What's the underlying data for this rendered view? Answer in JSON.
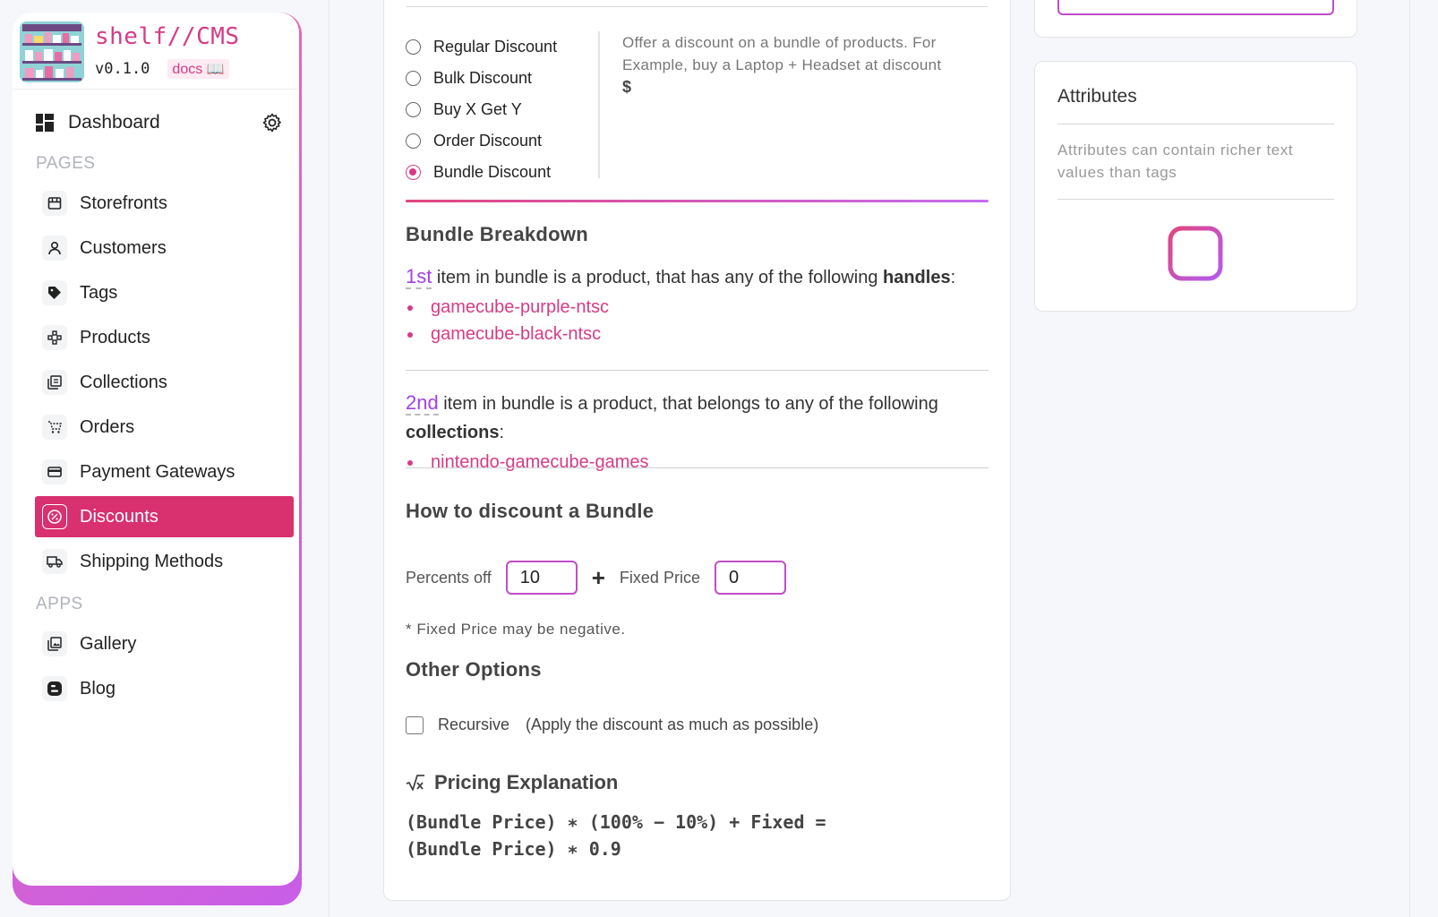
{
  "brand": {
    "name": "shelf//CMS",
    "version": "v0.1.0",
    "docs": "docs 📖"
  },
  "sidebar": {
    "dashboard": "Dashboard",
    "pages_label": "PAGES",
    "apps_label": "APPS",
    "pages": [
      {
        "label": "Storefronts",
        "icon": "storefront-icon"
      },
      {
        "label": "Customers",
        "icon": "user-icon"
      },
      {
        "label": "Tags",
        "icon": "tag-icon"
      },
      {
        "label": "Products",
        "icon": "products-icon"
      },
      {
        "label": "Collections",
        "icon": "collections-icon"
      },
      {
        "label": "Orders",
        "icon": "cart-icon"
      },
      {
        "label": "Payment Gateways",
        "icon": "credit-card-icon"
      },
      {
        "label": "Discounts",
        "icon": "discount-icon",
        "active": true
      },
      {
        "label": "Shipping Methods",
        "icon": "truck-icon"
      }
    ],
    "apps": [
      {
        "label": "Gallery",
        "icon": "gallery-icon"
      },
      {
        "label": "Blog",
        "icon": "blog-icon"
      }
    ]
  },
  "discount_types": {
    "options": [
      "Regular Discount",
      "Bulk Discount",
      "Buy X Get Y",
      "Order Discount",
      "Bundle Discount"
    ],
    "selected": "Bundle Discount",
    "description": "Offer a discount on a bundle of products. For Example, buy a Laptop + Headset at discount",
    "description_symbol": "$"
  },
  "bundle_breakdown": {
    "title": "Bundle Breakdown",
    "items": [
      {
        "ordinal": "1st",
        "text": " item in bundle is a product, that has any of the following ",
        "kind": "handles",
        "values": [
          "gamecube-purple-ntsc",
          "gamecube-black-ntsc"
        ]
      },
      {
        "ordinal": "2nd",
        "text": " item in bundle is a product, that belongs to any of the following ",
        "kind": "collections",
        "values": [
          "nintendo-gamecube-games"
        ]
      }
    ]
  },
  "how_to_discount": {
    "title": "How to discount a Bundle",
    "percents_label": "Percents off",
    "percents_value": "10",
    "plus": "+",
    "fixed_label": "Fixed Price",
    "fixed_value": "0",
    "note": "* Fixed Price may be negative."
  },
  "other_options": {
    "title": "Other Options",
    "recursive_label": "Recursive",
    "recursive_hint": "(Apply the discount as much as possible)",
    "recursive_checked": false
  },
  "pricing": {
    "title": "Pricing Explanation",
    "formula_line1": "(Bundle Price) ∗ (100% − 10%) + Fixed =",
    "formula_line2": "(Bundle Price) ∗ 0.9"
  },
  "attributes": {
    "title": "Attributes",
    "hint": "Attributes can contain richer text values than tags"
  },
  "colors": {
    "accent": "#d9306f",
    "link": "#d63b86",
    "ordinal": "#a142e6",
    "field_border": "#c04dc8"
  }
}
